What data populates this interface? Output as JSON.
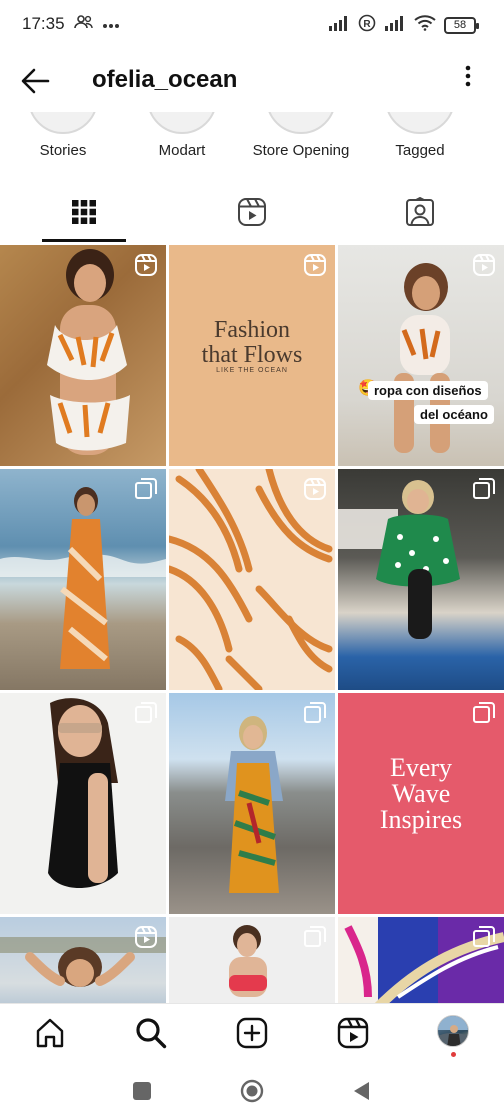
{
  "status_bar": {
    "time": "17:35",
    "left_icons": [
      "people-icon",
      "more-dots-icon"
    ],
    "right_icons": [
      "signal-icon",
      "registered-icon",
      "signal-icon",
      "wifi-icon"
    ],
    "battery": "58"
  },
  "header": {
    "username": "ofelia_ocean",
    "back_icon": "back-arrow-icon",
    "menu_icon": "more-vertical-icon"
  },
  "highlights": [
    {
      "label": "Stories"
    },
    {
      "label": "Modart"
    },
    {
      "label": "Store Opening"
    },
    {
      "label": "Tagged"
    }
  ],
  "tabs": [
    {
      "name": "posts",
      "icon": "grid-icon",
      "active": true
    },
    {
      "name": "reels",
      "icon": "reels-icon",
      "active": false
    },
    {
      "name": "tagged",
      "icon": "tagged-person-icon",
      "active": false
    }
  ],
  "posts": [
    {
      "type": "reel",
      "image": "woman in orange tiger-print swimsuit on rocks"
    },
    {
      "type": "reel",
      "title_line1": "Fashion",
      "title_line2": "that Flows",
      "subtitle": "LIKE THE OCEAN",
      "bg": "#E9B98A"
    },
    {
      "type": "reel",
      "caption_line1": "ropa con diseños",
      "caption_line2": "del océano",
      "emoji": "🤩"
    },
    {
      "type": "carousel",
      "image": "woman in patterned dress on beach"
    },
    {
      "type": "reel",
      "image": "orange palm leaf print fabric"
    },
    {
      "type": "carousel",
      "image": "woman by pool in green polka dot kimono"
    },
    {
      "type": "carousel",
      "image": "woman in black halter swimsuit with sunglasses"
    },
    {
      "type": "carousel",
      "image": "woman in colorful dress on pebble beach"
    },
    {
      "type": "carousel",
      "title_line1": "Every",
      "title_line2": "Wave",
      "title_line3": "Inspires",
      "bg": "#E55A6B"
    },
    {
      "type": "reel",
      "image": "woman on beach"
    },
    {
      "type": "carousel",
      "image": "woman in red bandeau"
    },
    {
      "type": "carousel",
      "image": "colorful woven fabric"
    }
  ],
  "bottom_nav": [
    "home-icon",
    "search-icon",
    "create-icon",
    "reels-icon",
    "profile-avatar"
  ],
  "system_nav": [
    "recents-square-icon",
    "home-circle-icon",
    "back-triangle-icon"
  ]
}
